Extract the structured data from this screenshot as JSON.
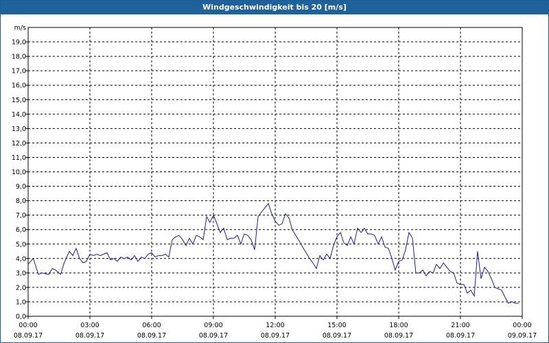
{
  "window": {
    "title": "Windgeschwindigkeit bis 20 [m/s]"
  },
  "colors": {
    "titlebar": "#1f6199",
    "line": "#1a1aa6",
    "grid": "#000000"
  },
  "chart_data": {
    "type": "line",
    "title": "Windgeschwindigkeit bis 20 [m/s]",
    "ylabel": "m/s",
    "xlabel": "",
    "ylim": [
      0,
      20
    ],
    "xlim_hours": [
      0,
      24
    ],
    "grid": true,
    "y_ticks": [
      "0,0",
      "1,0",
      "2,0",
      "3,0",
      "4,0",
      "5,0",
      "6,0",
      "7,0",
      "8,0",
      "9,0",
      "10,0",
      "11,0",
      "12,0",
      "13,0",
      "14,0",
      "15,0",
      "16,0",
      "17,0",
      "18,0",
      "19,0"
    ],
    "x_ticks": [
      {
        "time": "00:00",
        "date": "08.09.17"
      },
      {
        "time": "03:00",
        "date": "08.09.17"
      },
      {
        "time": "06:00",
        "date": "08.09.17"
      },
      {
        "time": "09:00",
        "date": "08.09.17"
      },
      {
        "time": "12:00",
        "date": "08.09.17"
      },
      {
        "time": "15:00",
        "date": "08.09.17"
      },
      {
        "time": "18:00",
        "date": "08.09.17"
      },
      {
        "time": "21:00",
        "date": "08.09.17"
      },
      {
        "time": "00:00",
        "date": "09.09.17"
      }
    ],
    "series": [
      {
        "x_hours": [
          0,
          0.25,
          0.5,
          0.67,
          1,
          1.17,
          1.33,
          1.58,
          1.75,
          2,
          2.17,
          2.33,
          2.5,
          2.67,
          2.83,
          3,
          3.17,
          3.33,
          3.5,
          3.67,
          3.83,
          4,
          4.17,
          4.33,
          4.5,
          4.67,
          4.83,
          5,
          5.17,
          5.33,
          5.5,
          5.67,
          5.83,
          6,
          6.17,
          6.33,
          6.5,
          6.67,
          6.83,
          7,
          7.17,
          7.33,
          7.5,
          7.67,
          7.83,
          8,
          8.17,
          8.33,
          8.5,
          8.67,
          8.83,
          9,
          9.17,
          9.33,
          9.5,
          9.67,
          9.83,
          10,
          10.17,
          10.33,
          10.5,
          10.67,
          10.83,
          11,
          11.17,
          11.33,
          11.5,
          11.67,
          11.83,
          12,
          12.17,
          12.33,
          12.5,
          12.67,
          12.83,
          13,
          13.17,
          13.33,
          13.5,
          13.67,
          13.83,
          14,
          14.17,
          14.33,
          14.5,
          14.67,
          14.83,
          15,
          15.17,
          15.33,
          15.5,
          15.67,
          15.83,
          16,
          16.17,
          16.33,
          16.5,
          16.67,
          16.83,
          17,
          17.17,
          17.33,
          17.5,
          17.67,
          17.83,
          18,
          18.17,
          18.33,
          18.5,
          18.67,
          18.83,
          19,
          19.17,
          19.33,
          19.5,
          19.67,
          19.83,
          20,
          20.17,
          20.33,
          20.5,
          20.67,
          20.83,
          21,
          21.17,
          21.33,
          21.5,
          21.67,
          21.83,
          22,
          22.17,
          22.33,
          22.5,
          22.67,
          22.83,
          23,
          23.17,
          23.33,
          23.5,
          23.67,
          23.83,
          24
        ],
        "values": [
          3.6,
          4.0,
          2.9,
          3.0,
          2.9,
          3.3,
          3.2,
          2.9,
          3.7,
          4.5,
          4.2,
          4.7,
          4.0,
          3.7,
          3.8,
          4.3,
          4.2,
          4.3,
          4.2,
          4.3,
          4.4,
          3.9,
          4.0,
          3.8,
          4.1,
          4.0,
          4.1,
          3.9,
          4.2,
          3.8,
          4.1,
          4.0,
          4.3,
          4.4,
          4.1,
          4.2,
          4.2,
          4.3,
          4.1,
          5.3,
          5.5,
          5.6,
          5.3,
          4.9,
          5.4,
          5.0,
          5.6,
          5.5,
          5.3,
          6.9,
          6.5,
          7.0,
          6.4,
          5.8,
          6.1,
          5.3,
          5.4,
          5.4,
          5.6,
          5.0,
          5.7,
          5.6,
          5.3,
          4.6,
          6.9,
          7.2,
          7.5,
          7.8,
          7.1,
          6.6,
          6.3,
          6.4,
          7.1,
          6.8,
          6.0,
          5.6,
          5.2,
          4.8,
          4.4,
          4.0,
          3.7,
          3.3,
          4.2,
          3.9,
          4.3,
          4.0,
          4.9,
          5.5,
          5.8,
          5.1,
          4.9,
          5.5,
          5.0,
          6.1,
          5.8,
          6.1,
          5.7,
          5.7,
          5.6,
          5.0,
          5.5,
          4.8,
          4.7,
          4.0,
          3.2,
          3.8,
          3.9,
          4.6,
          5.8,
          5.4,
          3.0,
          3.0,
          3.2,
          2.8,
          3.1,
          3.0,
          3.6,
          3.3,
          3.7,
          3.4,
          3.1,
          3.0,
          2.3,
          2.2,
          2.2,
          1.6,
          1.8,
          1.4,
          4.5,
          2.6,
          3.4,
          3.1,
          2.6,
          2.0,
          1.9,
          1.8,
          1.3,
          0.9,
          1.0,
          0.9,
          0.9
        ]
      }
    ]
  }
}
